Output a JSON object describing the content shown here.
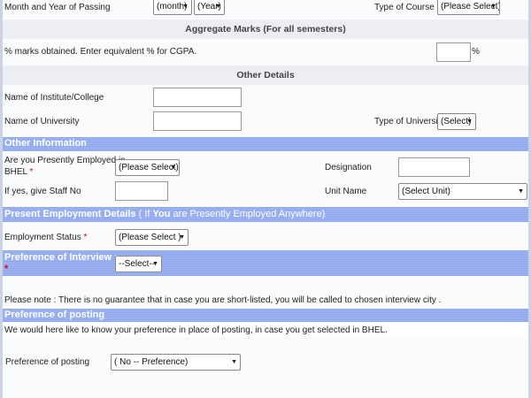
{
  "passing": {
    "label": "Month and Year of Passing",
    "month": "(month)",
    "year": "(Year)",
    "course_label": "Type of Course",
    "course_value": "(Please Select)"
  },
  "aggregate": {
    "title": "Aggregate Marks (For all semesters)",
    "label": "% marks obtained. Enter equivalent % for CGPA.",
    "value": "",
    "suffix": "%"
  },
  "other_details": {
    "title": "Other Details",
    "institute_label": "Name of Institute/College",
    "institute_value": "",
    "university_label": "Name of University",
    "university_value": "",
    "uni_type_label": "Type of University",
    "uni_type_value": "(Select)"
  },
  "other_info": {
    "title": "Other Information",
    "employed_label_1": "Are you Presently Employed in",
    "employed_label_2": "BHEL",
    "employed_value": "(Please Select)",
    "designation_label": "Designation",
    "designation_value": "",
    "staff_label": "If yes, give Staff No",
    "staff_value": "",
    "unit_label": "Unit Name",
    "unit_value": "(Select Unit)"
  },
  "employment": {
    "title": "Present Employment Details",
    "title_note_paren_open": "( If ",
    "title_note_you": "You",
    "title_note_rest": " are Presently Employed Anywhere)",
    "status_label": "Employment Status",
    "status_value": "(Please Select )"
  },
  "interview": {
    "title": "Preference of Interview :",
    "value": "--Select--",
    "note": "Please note : There is no guarantee that in case you are short-listed, you will be called to chosen interview city ."
  },
  "posting": {
    "title": "Preference of posting",
    "note": "We would here like to know your preference in place of posting, in case you get selected in BHEL.",
    "label": "Preference of posting",
    "value": "( No -- Preference)"
  },
  "required_mark": "*",
  "dropdown_arrow": "▼",
  "colors": {
    "section_header": "#8aa4ee",
    "row_gray": "#eceef4",
    "required": "#dd0000"
  }
}
